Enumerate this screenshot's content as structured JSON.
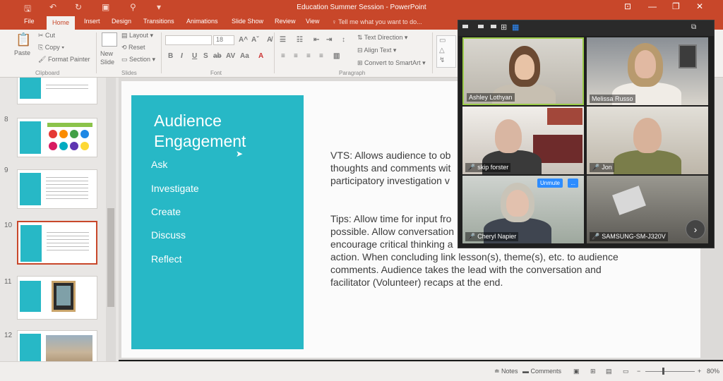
{
  "window": {
    "title": "Education Summer Session - PowerPoint"
  },
  "tabs": [
    "File",
    "Home",
    "Insert",
    "Design",
    "Transitions",
    "Animations",
    "Slide Show",
    "Review",
    "View"
  ],
  "tell_me": "Tell me what you want to do...",
  "ribbon": {
    "clipboard": {
      "paste": "Paste",
      "cut": "Cut",
      "copy": "Copy",
      "format_painter": "Format Painter",
      "label": "Clipboard"
    },
    "slides": {
      "new_slide": "New Slide",
      "layout": "Layout",
      "reset": "Reset",
      "section": "Section",
      "label": "Slides"
    },
    "font": {
      "size": "18",
      "label": "Font"
    },
    "paragraph": {
      "text_direction": "Text Direction",
      "align_text": "Align Text",
      "convert_smartart": "Convert to SmartArt",
      "label": "Paragraph"
    }
  },
  "thumbnails": {
    "numbers": [
      "8",
      "9",
      "10",
      "11",
      "12"
    ]
  },
  "slide": {
    "title": "Audience Engagement",
    "bullets": [
      "Ask",
      "Investigate",
      "Create",
      "Discuss",
      "Reflect"
    ],
    "vts_lines": [
      "VTS: Allows audience to ob",
      "thoughts and comments wit",
      "participatory investigation v"
    ],
    "tips_lines": [
      "Tips: Allow time for input fro",
      "possible. Allow conversation",
      "encourage critical thinking a",
      "action. When concluding link lesson(s), theme(s), etc. to audience",
      "comments. Audience takes the lead with the conversation and",
      "facilitator (Volunteer) recaps at the end."
    ]
  },
  "status": {
    "notes": "Notes",
    "comments": "Comments",
    "zoom": "80%"
  },
  "zoom": {
    "participants": [
      "Ashley Lothyan",
      "Melissa Russo",
      "skip forster",
      "Jon",
      "Cheryl Napier",
      "SAMSUNG-SM-J320V"
    ],
    "unmute": "Unmute",
    "more": "...",
    "next": "›"
  }
}
